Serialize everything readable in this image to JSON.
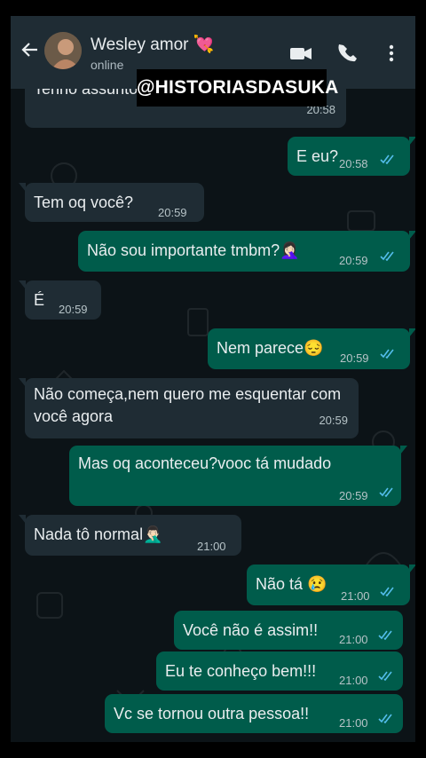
{
  "header": {
    "contact_name": "Wesley amor 💘",
    "status": "online"
  },
  "watermark": "@HISTORIASDASUKA",
  "colors": {
    "incoming_bubble": "#1f2c34",
    "outgoing_bubble": "#005c4b",
    "background": "#0c1317",
    "read_ticks": "#53bdeb"
  },
  "messages": [
    {
      "dir": "in",
      "text": "Tenho assuntos mais importantes",
      "time": "20:58"
    },
    {
      "dir": "out",
      "text": "E eu?",
      "time": "20:58",
      "status": "read"
    },
    {
      "dir": "in",
      "text": "Tem oq você?",
      "time": "20:59"
    },
    {
      "dir": "out",
      "text": "Não sou importante tmbm?🤦🏻‍♀️",
      "time": "20:59",
      "status": "read"
    },
    {
      "dir": "in",
      "text": "É",
      "time": "20:59"
    },
    {
      "dir": "out",
      "text": "Nem parece😔",
      "time": "20:59",
      "status": "read"
    },
    {
      "dir": "in",
      "text": "Não começa,nem quero me esquentar com você agora",
      "time": "20:59"
    },
    {
      "dir": "out",
      "text": "Mas oq aconteceu?vooc tá mudado",
      "time": "20:59",
      "status": "read"
    },
    {
      "dir": "in",
      "text": "Nada tô normal🤦🏻‍♂️",
      "time": "21:00"
    },
    {
      "dir": "out",
      "text": "Não tá 😢",
      "time": "21:00",
      "status": "read"
    },
    {
      "dir": "out",
      "text": "Você não é assim!!",
      "time": "21:00",
      "status": "read"
    },
    {
      "dir": "out",
      "text": "Eu te conheço bem!!!",
      "time": "21:00",
      "status": "read"
    },
    {
      "dir": "out",
      "text": "Vc se tornou outra pessoa!!",
      "time": "21:00",
      "status": "read"
    }
  ]
}
